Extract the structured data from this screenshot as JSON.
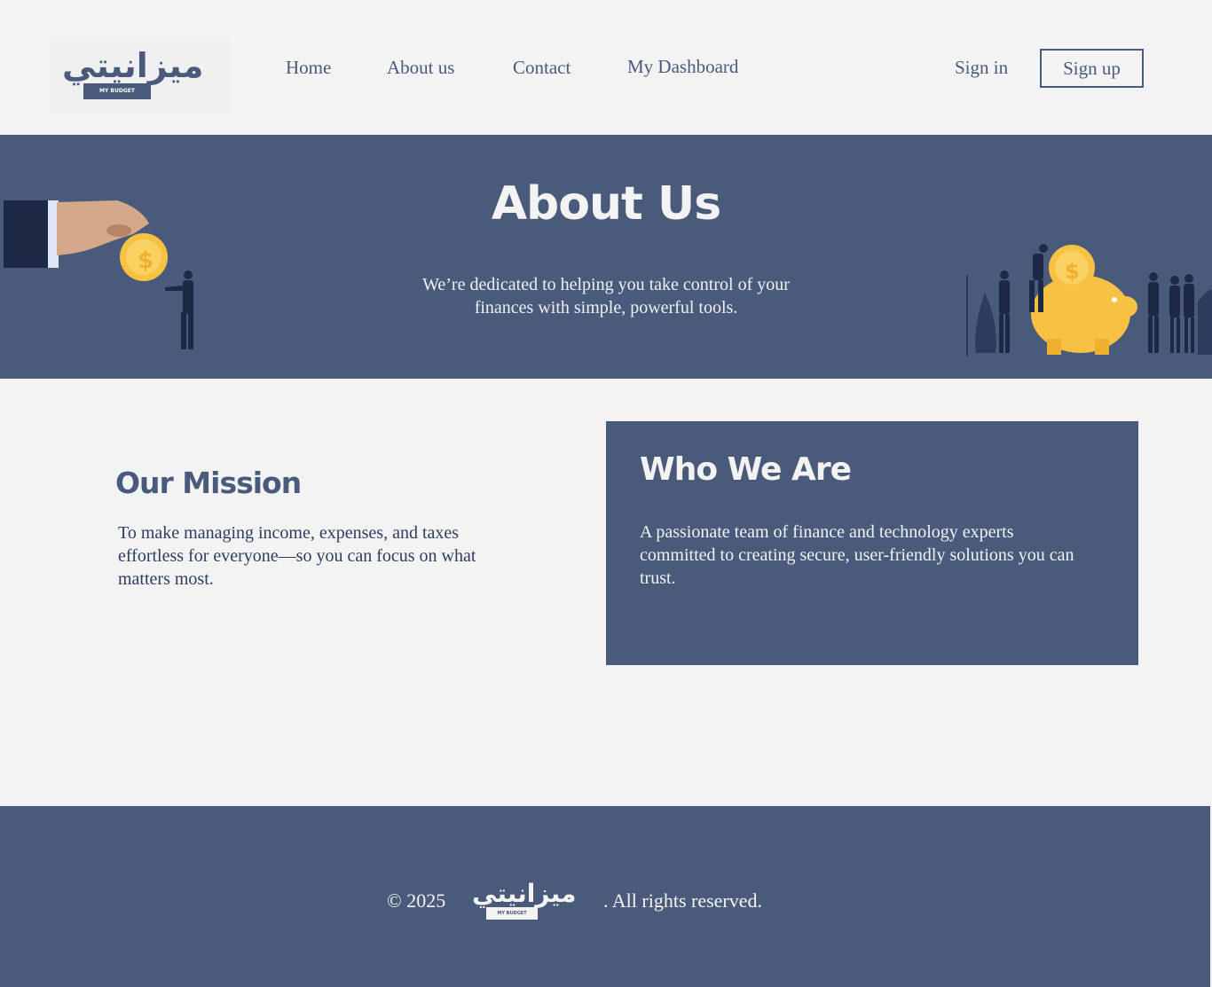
{
  "header": {
    "logo": {
      "arabic_text": "ميزانيتي",
      "tagline": "MY BUDGET"
    },
    "nav": {
      "home": "Home",
      "about": "About us",
      "contact": "Contact",
      "dashboard": "My Dashboard"
    },
    "sign_in": "Sign in",
    "sign_up": "Sign up"
  },
  "hero": {
    "title": "About Us",
    "subtitle": "We’re dedicated to helping you take control of your finances with simple, powerful tools."
  },
  "mission": {
    "title": "Our Mission",
    "text": "To make managing income, expenses, and taxes effortless for everyone—so you can focus on what matters most."
  },
  "who": {
    "title": "Who We Are",
    "text": "A passionate team of finance and technology experts committed to creating secure, user-friendly solutions you can trust."
  },
  "footer": {
    "copyright": "© 2025",
    "logo": {
      "arabic_text": "ميزانيتي",
      "tagline": "MY BUDGET"
    },
    "rights": ". All rights reserved."
  },
  "colors": {
    "primary": "#4a5a7a",
    "background": "#f3f3f3",
    "coin": "#f7c244",
    "dark_suit": "#1e2a45"
  }
}
